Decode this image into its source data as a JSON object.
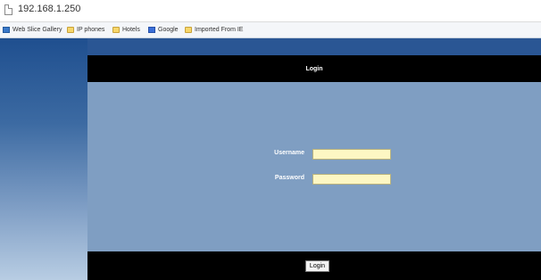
{
  "browser": {
    "url": "192.168.1.250",
    "bookmarks": [
      {
        "label": "Web Slice Gallery",
        "icon": "web-slice-icon"
      },
      {
        "label": "IP phones",
        "icon": "folder-icon"
      },
      {
        "label": "Hotels",
        "icon": "folder-icon"
      },
      {
        "label": "Google",
        "icon": "google-icon"
      },
      {
        "label": "Imported From IE",
        "icon": "folder-icon"
      }
    ]
  },
  "login": {
    "title": "Login",
    "username_label": "Username",
    "username_value": "",
    "password_label": "Password",
    "password_value": "",
    "submit_label": "Login"
  },
  "colors": {
    "header_bg": "#000000",
    "form_bg": "#7f9ec2",
    "field_bg": "#fdf7c3",
    "sidebar_top": "#1f4f8f",
    "sidebar_bottom": "#b8cde3"
  }
}
